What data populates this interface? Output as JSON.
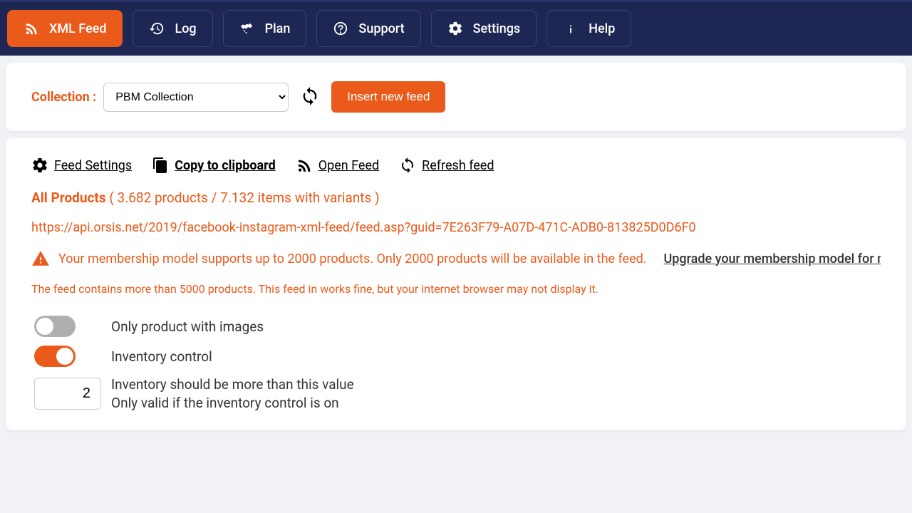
{
  "nav": {
    "xml_feed": "XML Feed",
    "log": "Log",
    "plan": "Plan",
    "support": "Support",
    "settings": "Settings",
    "help": "Help"
  },
  "collection": {
    "label": "Collection :",
    "selected": "PBM Collection",
    "options": [
      "PBM Collection"
    ],
    "insert_btn": "Insert new feed"
  },
  "feed_actions": {
    "settings": " Feed Settings",
    "copy": " Copy to clipboard",
    "open": " Open Feed",
    "refresh": " Refresh feed"
  },
  "products": {
    "title": "All Products",
    "stats": " ( 3.682 products / 7.132 items with variants )"
  },
  "feed_url": "https://api.orsis.net/2019/facebook-instagram-xml-feed/feed.asp?guid=7E263F79-A07D-471C-ADB0-813825D0D6F0",
  "warning": {
    "text": "Your membership model supports up to 2000 products. Only 2000 products will be available in the feed.",
    "upgrade": "Upgrade your membership model for m"
  },
  "note": "The feed contains more than 5000 products. This feed in works fine, but your internet browser may not display it.",
  "toggles": {
    "only_images": {
      "label": "Only product with images",
      "on": false
    },
    "inventory_control": {
      "label": "Inventory control",
      "on": true
    }
  },
  "inventory_input": {
    "value": "2",
    "desc_line1": "Inventory should be more than this value",
    "desc_line2": "Only valid if the inventory control is on"
  }
}
